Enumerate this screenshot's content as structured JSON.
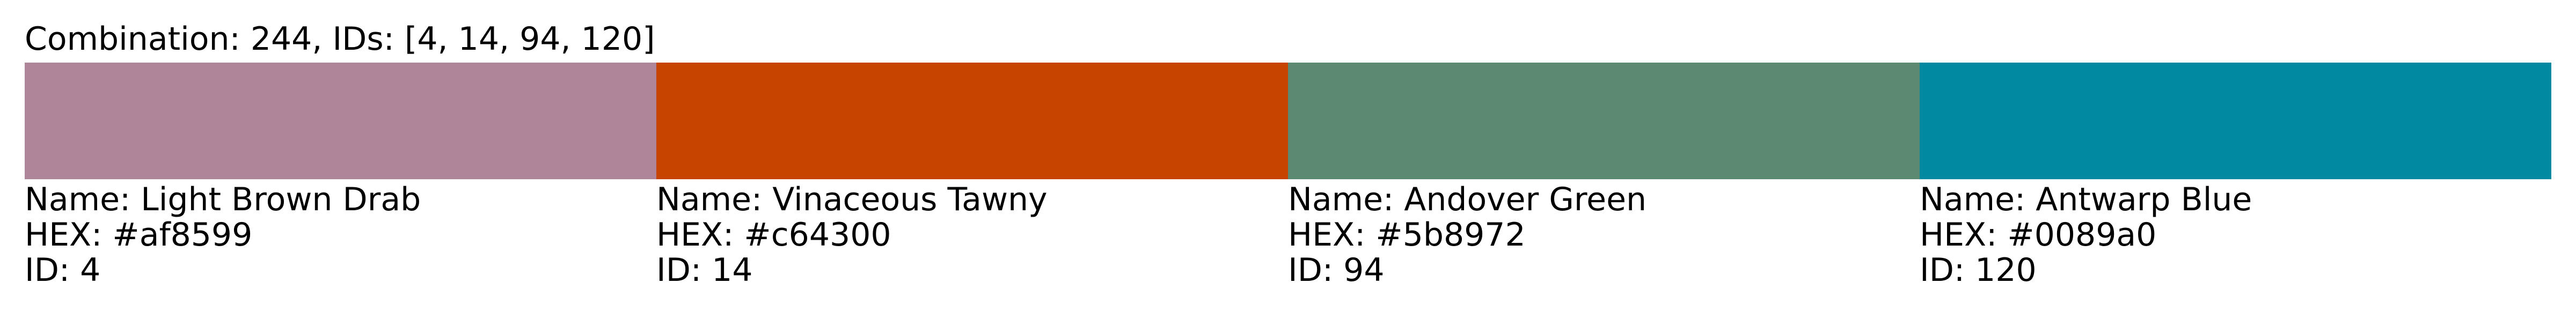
{
  "title": "Combination: 244, IDs: [4, 14, 94, 120]",
  "colors": [
    {
      "name_line": "Name: Light Brown Drab",
      "hex_line": "HEX: #af8599",
      "id_line": "ID: 4",
      "hex": "#af8599"
    },
    {
      "name_line": "Name: Vinaceous Tawny",
      "hex_line": "HEX: #c64300",
      "id_line": "ID: 14",
      "hex": "#c64300"
    },
    {
      "name_line": "Name: Andover Green",
      "hex_line": "HEX: #5b8972",
      "id_line": "ID: 94",
      "hex": "#5b8972"
    },
    {
      "name_line": "Name: Antwarp Blue",
      "hex_line": "HEX: #0089a0",
      "id_line": "ID: 120",
      "hex": "#0089a0"
    }
  ]
}
